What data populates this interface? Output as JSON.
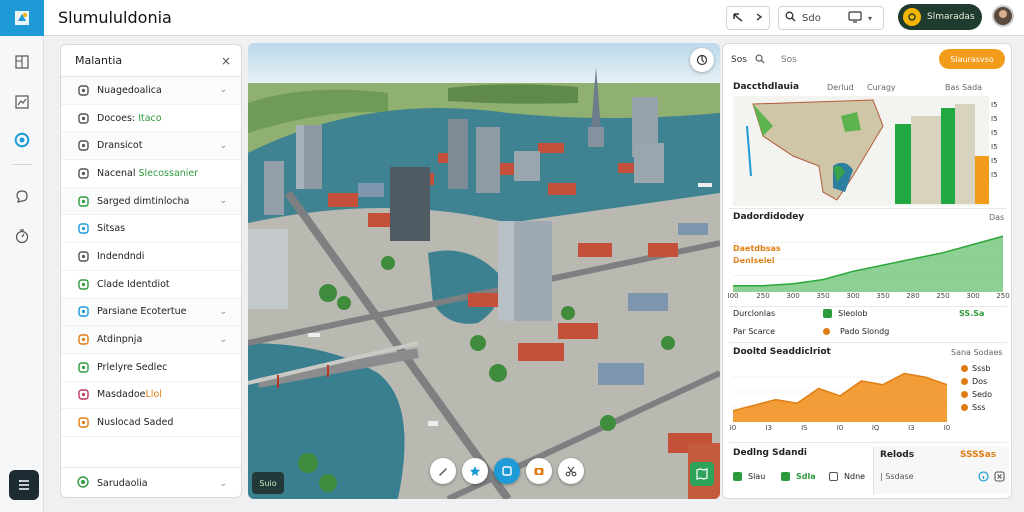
{
  "app": {
    "title": "Slumululdonia"
  },
  "toolbar": {
    "search_label": "Sdo",
    "cta_label": "Slmaradas"
  },
  "panel": {
    "title": "Malantia",
    "items": [
      {
        "label": "Nuagedoalica",
        "icon": "layers-icon",
        "chevron": true,
        "sub": ""
      },
      {
        "label": "Docoes: ",
        "icon": "settings-icon",
        "chevron": false,
        "sub": "Itaco"
      },
      {
        "label": "Dransicot",
        "icon": "document-icon",
        "chevron": true,
        "sub": ""
      },
      {
        "label": "Nacenal ",
        "icon": "clock-icon",
        "chevron": false,
        "sub": "Slecossanier"
      },
      {
        "label": "Sarged dimtinlocha",
        "icon": "shield-icon",
        "chevron": true,
        "sub": ""
      },
      {
        "label": "Sitsas",
        "icon": "table-icon",
        "chevron": false,
        "sub": ""
      },
      {
        "label": "Indendndi",
        "icon": "building-icon",
        "chevron": false,
        "sub": ""
      },
      {
        "label": "Clade Identdiot",
        "icon": "grid-icon",
        "chevron": false,
        "sub": ""
      },
      {
        "label": "Parsiane Ecotertue",
        "icon": "water-drop-icon",
        "chevron": true,
        "sub": ""
      },
      {
        "label": "Atdinpnja",
        "icon": "chart-icon",
        "chevron": true,
        "sub": ""
      },
      {
        "label": "Prlelyre Sedlec",
        "icon": "globe-icon",
        "chevron": false,
        "sub": ""
      },
      {
        "label": "Masdadoe",
        "icon": "pin-icon",
        "chevron": false,
        "sub": "Llol"
      },
      {
        "label": "Nuslocad Saded",
        "icon": "folder-icon",
        "chevron": false,
        "sub": ""
      }
    ],
    "footer_label": "Sarudaolia"
  },
  "map": {
    "badge": "Suio"
  },
  "right": {
    "tab": "Sos",
    "search": "Sos",
    "button": "Slaurasvso",
    "map_section": {
      "title": "Daccthdlauia",
      "sub1": "Derlud",
      "sub2": "Curagy",
      "sub3": "Bas Sada"
    },
    "dist": {
      "title": "Dadordidodey",
      "sub": "Das",
      "legend1": "Daetdbsas",
      "legend2": "Denlseiel"
    },
    "kpi": [
      {
        "label": "Durclonlas",
        "value_label": "Sleolob",
        "value": "SS.Sa",
        "color": "green"
      },
      {
        "label": "Par Scarce",
        "value_label": "Pado Slondg",
        "value": "",
        "color": "orange"
      }
    ],
    "trend": {
      "title": "Dooltd Seaddiclriot",
      "sub": "Sana Sodaes",
      "legend": [
        "Sssb",
        "Dos",
        "Sedo",
        "Sss"
      ]
    },
    "bottom": {
      "title": "Dedlng Sdandi",
      "items": [
        "Slau",
        "Sdla",
        "Ndne"
      ],
      "cost_title": "Relods",
      "cost_value": "SSSSas",
      "cost_sub": "Ssdase"
    }
  },
  "chart_data": [
    {
      "type": "area",
      "title": "Dadordidodey",
      "x": [
        "I00",
        "250",
        "300",
        "350",
        "300",
        "350",
        "280",
        "250",
        "300",
        "250"
      ],
      "series": [
        {
          "name": "Daetdbsas",
          "values": [
            3,
            3,
            4,
            6,
            10,
            13,
            16,
            19,
            23,
            27
          ]
        }
      ],
      "ylim": [
        0,
        30
      ]
    },
    {
      "type": "area",
      "title": "Dooltd Seaddiclriot",
      "x": [
        "I0",
        "I3",
        "IS",
        "I0",
        "IQ",
        "I3",
        "I0"
      ],
      "series": [
        {
          "name": "Sssb",
          "values": [
            6,
            9,
            12,
            10,
            18,
            14,
            22,
            20,
            26,
            24,
            20
          ]
        }
      ],
      "ylim": [
        0,
        30
      ]
    }
  ]
}
